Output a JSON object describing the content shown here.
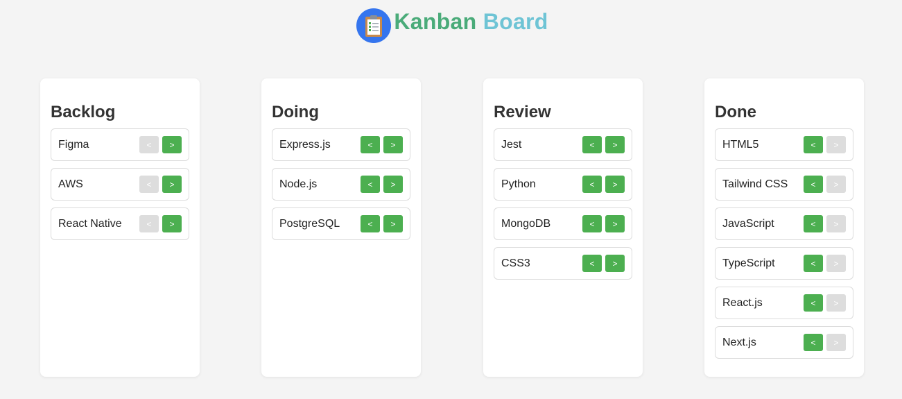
{
  "header": {
    "title_part1": "Kanban",
    "title_part2": "Board",
    "logo_icon": "clipboard-icon",
    "colors": {
      "accent_green": "#4aab79",
      "accent_teal": "#6ec4d5",
      "logo_bg": "#3575ee"
    }
  },
  "buttons": {
    "prev_label": "<",
    "next_label": ">"
  },
  "columns": [
    {
      "title": "Backlog",
      "cards": [
        {
          "label": "Figma",
          "prev_enabled": false,
          "next_enabled": true
        },
        {
          "label": "AWS",
          "prev_enabled": false,
          "next_enabled": true
        },
        {
          "label": "React Native",
          "prev_enabled": false,
          "next_enabled": true
        }
      ]
    },
    {
      "title": "Doing",
      "cards": [
        {
          "label": "Express.js",
          "prev_enabled": true,
          "next_enabled": true
        },
        {
          "label": "Node.js",
          "prev_enabled": true,
          "next_enabled": true
        },
        {
          "label": "PostgreSQL",
          "prev_enabled": true,
          "next_enabled": true
        }
      ]
    },
    {
      "title": "Review",
      "cards": [
        {
          "label": "Jest",
          "prev_enabled": true,
          "next_enabled": true
        },
        {
          "label": "Python",
          "prev_enabled": true,
          "next_enabled": true
        },
        {
          "label": "MongoDB",
          "prev_enabled": true,
          "next_enabled": true
        },
        {
          "label": "CSS3",
          "prev_enabled": true,
          "next_enabled": true
        }
      ]
    },
    {
      "title": "Done",
      "cards": [
        {
          "label": "HTML5",
          "prev_enabled": true,
          "next_enabled": false
        },
        {
          "label": "Tailwind CSS",
          "prev_enabled": true,
          "next_enabled": false
        },
        {
          "label": "JavaScript",
          "prev_enabled": true,
          "next_enabled": false
        },
        {
          "label": "TypeScript",
          "prev_enabled": true,
          "next_enabled": false
        },
        {
          "label": "React.js",
          "prev_enabled": true,
          "next_enabled": false
        },
        {
          "label": "Next.js",
          "prev_enabled": true,
          "next_enabled": false
        }
      ]
    }
  ]
}
